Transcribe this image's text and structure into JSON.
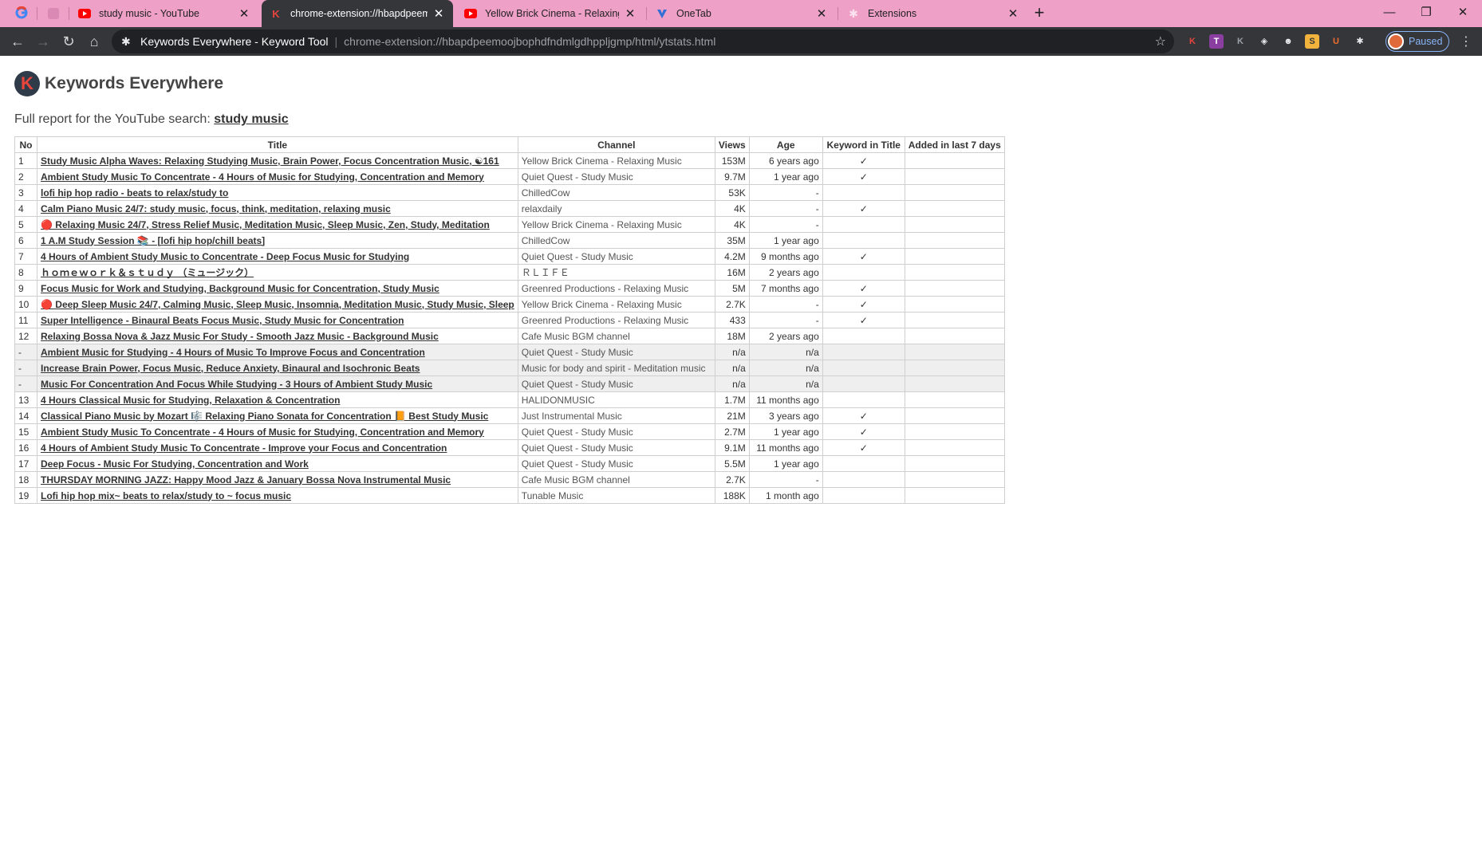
{
  "browser": {
    "tabs": [
      {
        "label": "study music - YouTube",
        "icon": "youtube-icon"
      },
      {
        "label": "chrome-extension://hbapdpeem",
        "icon": "keywords-everywhere-icon"
      },
      {
        "label": "Yellow Brick Cinema - Relaxing M",
        "icon": "youtube-icon"
      },
      {
        "label": "OneTab",
        "icon": "onetab-icon"
      },
      {
        "label": "Extensions",
        "icon": "puzzle-icon"
      }
    ],
    "address": {
      "extension_name": "Keywords Everywhere - Keyword Tool",
      "url": "chrome-extension://hbapdpeemoojbophdfndmlgdhppljgmp/html/ytstats.html"
    },
    "profile_label": "Paused"
  },
  "page": {
    "brand": "Keywords Everywhere",
    "subtitle_prefix": "Full report for the YouTube search:",
    "query": "study music"
  },
  "table": {
    "headers": [
      "No",
      "Title",
      "Channel",
      "Views",
      "Age",
      "Keyword in Title",
      "Added in last 7 days"
    ],
    "rows": [
      {
        "no": "1",
        "title": "Study Music Alpha Waves: Relaxing Studying Music, Brain Power, Focus Concentration Music, ☯161",
        "channel": "Yellow Brick Cinema - Relaxing Music",
        "views": "153M",
        "age": "6 years ago",
        "kw": "✓",
        "added": "",
        "grey": false
      },
      {
        "no": "2",
        "title": "Ambient Study Music To Concentrate - 4 Hours of Music for Studying, Concentration and Memory",
        "channel": "Quiet Quest - Study Music",
        "views": "9.7M",
        "age": "1 year ago",
        "kw": "✓",
        "added": "",
        "grey": false
      },
      {
        "no": "3",
        "title": "lofi hip hop radio - beats to relax/study to",
        "channel": "ChilledCow",
        "views": "53K",
        "age": "-",
        "kw": "",
        "added": "",
        "grey": false
      },
      {
        "no": "4",
        "title": "Calm Piano Music 24/7: study music, focus, think, meditation, relaxing music",
        "channel": "relaxdaily",
        "views": "4K",
        "age": "-",
        "kw": "✓",
        "added": "",
        "grey": false
      },
      {
        "no": "5",
        "title": "🔴 Relaxing Music 24/7, Stress Relief Music, Meditation Music, Sleep Music, Zen, Study, Meditation",
        "channel": "Yellow Brick Cinema - Relaxing Music",
        "views": "4K",
        "age": "-",
        "kw": "",
        "added": "",
        "grey": false
      },
      {
        "no": "6",
        "title": "1 A.M Study Session 📚 - [lofi hip hop/chill beats]",
        "channel": "ChilledCow",
        "views": "35M",
        "age": "1 year ago",
        "kw": "",
        "added": "",
        "grey": false
      },
      {
        "no": "7",
        "title": "4 Hours of Ambient Study Music to Concentrate - Deep Focus Music for Studying",
        "channel": "Quiet Quest - Study Music",
        "views": "4.2M",
        "age": "9 months ago",
        "kw": "✓",
        "added": "",
        "grey": false
      },
      {
        "no": "8",
        "title": "ｈｏｍｅｗｏｒｋ＆ｓｔｕｄｙ （ミュージック）",
        "channel": "ＲＬＩＦＥ",
        "views": "16M",
        "age": "2 years ago",
        "kw": "",
        "added": "",
        "grey": false
      },
      {
        "no": "9",
        "title": "Focus Music for Work and Studying, Background Music for Concentration, Study Music",
        "channel": "Greenred Productions - Relaxing Music",
        "views": "5M",
        "age": "7 months ago",
        "kw": "✓",
        "added": "",
        "grey": false
      },
      {
        "no": "10",
        "title": "🔴 Deep Sleep Music 24/7, Calming Music, Sleep Music, Insomnia, Meditation Music, Study Music, Sleep",
        "channel": "Yellow Brick Cinema - Relaxing Music",
        "views": "2.7K",
        "age": "-",
        "kw": "✓",
        "added": "",
        "grey": false
      },
      {
        "no": "11",
        "title": "Super Intelligence - Binaural Beats Focus Music, Study Music for Concentration",
        "channel": "Greenred Productions - Relaxing Music",
        "views": "433",
        "age": "-",
        "kw": "✓",
        "added": "",
        "grey": false
      },
      {
        "no": "12",
        "title": "Relaxing Bossa Nova & Jazz Music For Study - Smooth Jazz Music - Background Music",
        "channel": "Cafe Music BGM channel",
        "views": "18M",
        "age": "2 years ago",
        "kw": "",
        "added": "",
        "grey": false
      },
      {
        "no": "-",
        "title": "Ambient Music for Studying - 4 Hours of Music To Improve Focus and Concentration",
        "channel": "Quiet Quest - Study Music",
        "views": "n/a",
        "age": "n/a",
        "kw": "",
        "added": "",
        "grey": true
      },
      {
        "no": "-",
        "title": "Increase Brain Power, Focus Music, Reduce Anxiety, Binaural and Isochronic Beats",
        "channel": "Music for body and spirit - Meditation music",
        "views": "n/a",
        "age": "n/a",
        "kw": "",
        "added": "",
        "grey": true
      },
      {
        "no": "-",
        "title": "Music For Concentration And Focus While Studying - 3 Hours of Ambient Study Music",
        "channel": "Quiet Quest - Study Music",
        "views": "n/a",
        "age": "n/a",
        "kw": "",
        "added": "",
        "grey": true
      },
      {
        "no": "13",
        "title": "4 Hours Classical Music for Studying, Relaxation & Concentration",
        "channel": "HALIDONMUSIC",
        "views": "1.7M",
        "age": "11 months ago",
        "kw": "",
        "added": "",
        "grey": false
      },
      {
        "no": "14",
        "title": "Classical Piano Music by Mozart 🎼 Relaxing Piano Sonata for Concentration 📙 Best Study Music",
        "channel": "Just Instrumental Music",
        "views": "21M",
        "age": "3 years ago",
        "kw": "✓",
        "added": "",
        "grey": false
      },
      {
        "no": "15",
        "title": "Ambient Study Music To Concentrate - 4 Hours of Music for Studying, Concentration and Memory",
        "channel": "Quiet Quest - Study Music",
        "views": "2.7M",
        "age": "1 year ago",
        "kw": "✓",
        "added": "",
        "grey": false
      },
      {
        "no": "16",
        "title": "4 Hours of Ambient Study Music To Concentrate - Improve your Focus and Concentration",
        "channel": "Quiet Quest - Study Music",
        "views": "9.1M",
        "age": "11 months ago",
        "kw": "✓",
        "added": "",
        "grey": false
      },
      {
        "no": "17",
        "title": "Deep Focus - Music For Studying, Concentration and Work",
        "channel": "Quiet Quest - Study Music",
        "views": "5.5M",
        "age": "1 year ago",
        "kw": "",
        "added": "",
        "grey": false
      },
      {
        "no": "18",
        "title": "THURSDAY MORNING JAZZ: Happy Mood Jazz & January Bossa Nova Instrumental Music",
        "channel": "Cafe Music BGM channel",
        "views": "2.7K",
        "age": "-",
        "kw": "",
        "added": "",
        "grey": false
      },
      {
        "no": "19",
        "title": "Lofi hip hop mix~ beats to relax/study to ~ focus music",
        "channel": "Tunable Music",
        "views": "188K",
        "age": "1 month ago",
        "kw": "",
        "added": "",
        "grey": false
      }
    ]
  }
}
